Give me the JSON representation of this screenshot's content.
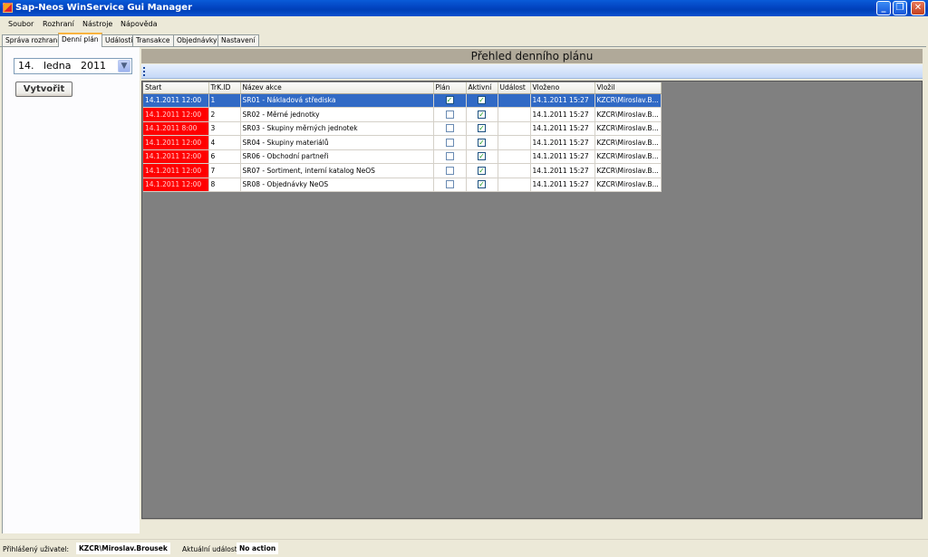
{
  "window": {
    "title": "Sap-Neos WinService Gui Manager"
  },
  "menu": [
    "Soubor",
    "Rozhraní",
    "Nástroje",
    "Nápověda"
  ],
  "tabs": [
    "Správa rozhraní",
    "Denní plán",
    "Události",
    "Transakce",
    "Objednávky",
    "Nastavení"
  ],
  "active_tab": "Denní plán",
  "left": {
    "date": "14.   ledna   2011",
    "create_button": "Vytvořit"
  },
  "main": {
    "title": "Přehled denního plánu",
    "columns": [
      "Start",
      "TrK.ID",
      "Název akce",
      "Plán",
      "Aktivní",
      "Událost",
      "Vloženo",
      "Vložil"
    ],
    "rows": [
      {
        "start": "14.1.2011 12:00",
        "id": "1",
        "name": "SR01 - Nákladová střediska",
        "plan": true,
        "active": true,
        "event": "",
        "inserted": "14.1.2011 15:27",
        "by": "KZCR\\Miroslav.B..."
      },
      {
        "start": "14.1.2011 12:00",
        "id": "2",
        "name": "SR02 - Měrné jednotky",
        "plan": false,
        "active": true,
        "event": "",
        "inserted": "14.1.2011 15:27",
        "by": "KZCR\\Miroslav.B..."
      },
      {
        "start": "14.1.2011 8:00",
        "id": "3",
        "name": "SR03 - Skupiny měrných jednotek",
        "plan": false,
        "active": true,
        "event": "",
        "inserted": "14.1.2011 15:27",
        "by": "KZCR\\Miroslav.B..."
      },
      {
        "start": "14.1.2011 12:00",
        "id": "4",
        "name": "SR04 - Skupiny materiálů",
        "plan": false,
        "active": true,
        "event": "",
        "inserted": "14.1.2011 15:27",
        "by": "KZCR\\Miroslav.B..."
      },
      {
        "start": "14.1.2011 12:00",
        "id": "6",
        "name": "SR06 - Obchodní partneři",
        "plan": false,
        "active": true,
        "event": "",
        "inserted": "14.1.2011 15:27",
        "by": "KZCR\\Miroslav.B..."
      },
      {
        "start": "14.1.2011 12:00",
        "id": "7",
        "name": "SR07 - Sortiment, interní katalog NeOS",
        "plan": false,
        "active": true,
        "event": "",
        "inserted": "14.1.2011 15:27",
        "by": "KZCR\\Miroslav.B..."
      },
      {
        "start": "14.1.2011 12:00",
        "id": "8",
        "name": "SR08 - Objednávky NeOS",
        "plan": false,
        "active": true,
        "event": "",
        "inserted": "14.1.2011 15:27",
        "by": "KZCR\\Miroslav.B..."
      }
    ],
    "selected_row": 0
  },
  "status": {
    "user_label": "Přihlášený uživatel:",
    "user_value": "KZCR\\Miroslav.Brousek",
    "event_label": "Aktuální událost:",
    "event_value": "No action"
  },
  "colors": {
    "start_cell": "#ff0000",
    "selection": "#316ac5",
    "title_bar": "#0a52cf",
    "grid_bg": "#808080"
  }
}
